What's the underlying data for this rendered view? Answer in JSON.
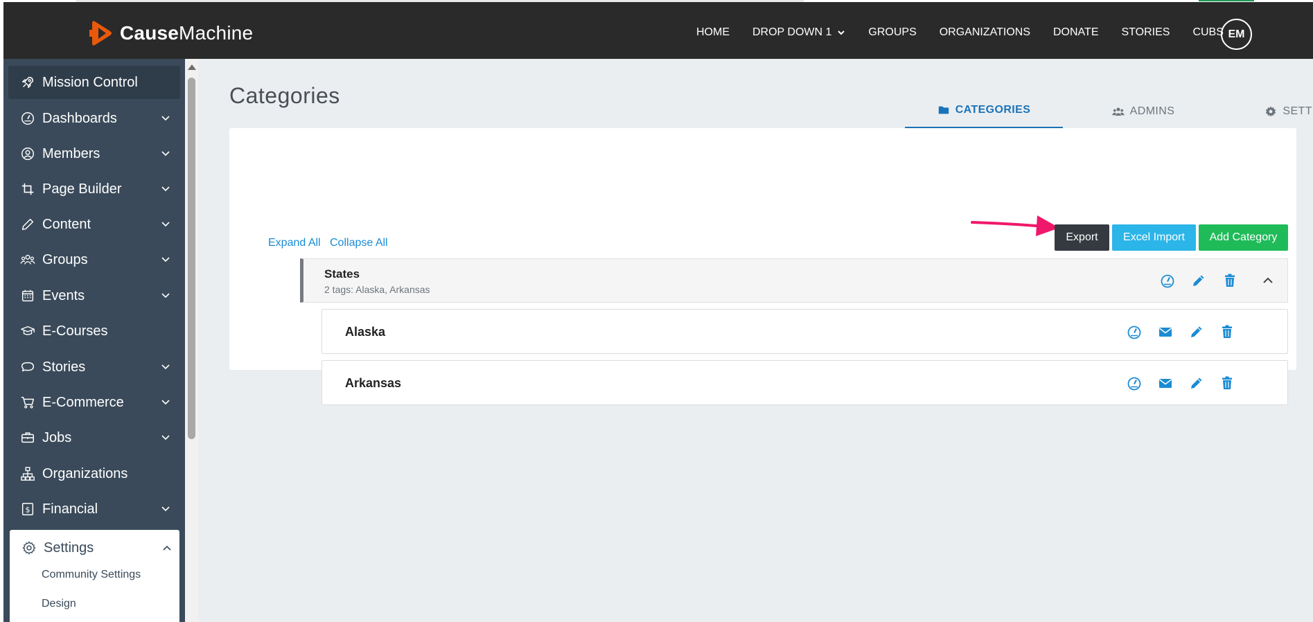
{
  "brand": {
    "name_bold": "Cause",
    "name_light": "Machine",
    "accent": "#e8590c"
  },
  "nav": {
    "items": [
      "HOME",
      "DROP DOWN 1",
      "GROUPS",
      "ORGANIZATIONS",
      "DONATE",
      "STORIES",
      "CUBS"
    ],
    "avatar": "EM"
  },
  "sidebar": {
    "items": [
      {
        "label": "Mission Control",
        "icon": "rocket-icon",
        "chevron": false
      },
      {
        "label": "Dashboards",
        "icon": "gauge-icon",
        "chevron": true
      },
      {
        "label": "Members",
        "icon": "user-circle-icon",
        "chevron": true
      },
      {
        "label": "Page Builder",
        "icon": "crop-icon",
        "chevron": true
      },
      {
        "label": "Content",
        "icon": "pencil-icon",
        "chevron": true
      },
      {
        "label": "Groups",
        "icon": "users-icon",
        "chevron": true
      },
      {
        "label": "Events",
        "icon": "calendar-icon",
        "chevron": true
      },
      {
        "label": "E-Courses",
        "icon": "graduation-cap-icon",
        "chevron": false
      },
      {
        "label": "Stories",
        "icon": "chat-bubble-icon",
        "chevron": true
      },
      {
        "label": "E-Commerce",
        "icon": "cart-icon",
        "chevron": true
      },
      {
        "label": "Jobs",
        "icon": "briefcase-icon",
        "chevron": true
      },
      {
        "label": "Organizations",
        "icon": "org-chart-icon",
        "chevron": false
      },
      {
        "label": "Financial",
        "icon": "dollar-icon",
        "chevron": true
      }
    ],
    "settings": {
      "label": "Settings",
      "icon": "gear-icon",
      "subitems": [
        "Community Settings",
        "Design"
      ]
    }
  },
  "page": {
    "title": "Categories",
    "tabs": [
      "CATEGORIES",
      "ADMINS",
      "SETTINGS"
    ],
    "active_tab": "CATEGORIES",
    "expand_all": "Expand All",
    "collapse_all": "Collapse All",
    "buttons": {
      "export": "Export",
      "excel_import": "Excel Import",
      "add_category": "Add Category"
    },
    "category": {
      "title": "States",
      "subtitle": "2 tags: Alaska, Arkansas"
    },
    "children": [
      "Alaska",
      "Arkansas"
    ]
  },
  "colors": {
    "topbar": "#2a2a2a",
    "sidebar": "#3a4a5a",
    "link": "#1a8bd4",
    "active_tab": "#1a73b8",
    "export": "#343a40",
    "excel": "#2cb5e8",
    "add": "#1fbb59",
    "annotation_arrow": "#f0186a"
  }
}
